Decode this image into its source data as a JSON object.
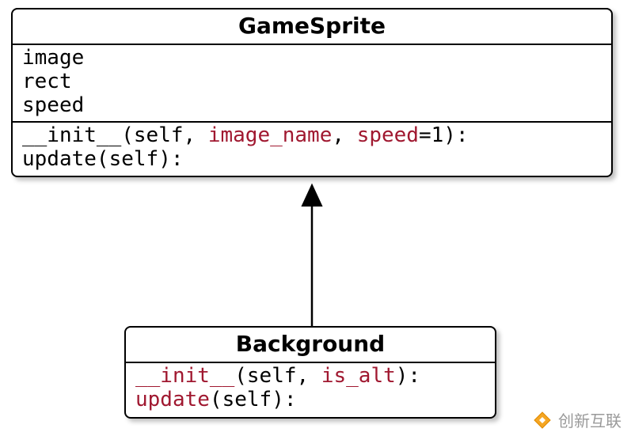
{
  "diagram": {
    "parent": {
      "name": "GameSprite",
      "attributes": [
        "image",
        "rect",
        "speed"
      ],
      "methods": [
        {
          "name": "__init__",
          "params": [
            {
              "text": "self",
              "kind": "plain"
            },
            {
              "text": "image_name",
              "kind": "param"
            },
            {
              "text": "speed",
              "kind": "param",
              "default": "1"
            }
          ]
        },
        {
          "name": "update",
          "params": [
            {
              "text": "self",
              "kind": "plain"
            }
          ]
        }
      ]
    },
    "child": {
      "name": "Background",
      "methods": [
        {
          "name": "__init__",
          "color": "param",
          "params": [
            {
              "text": "self",
              "kind": "plain"
            },
            {
              "text": "is_alt",
              "kind": "param"
            }
          ]
        },
        {
          "name": "update",
          "color": "param",
          "params": [
            {
              "text": "self",
              "kind": "plain"
            }
          ]
        }
      ]
    }
  },
  "watermark": {
    "text": "创新互联"
  }
}
